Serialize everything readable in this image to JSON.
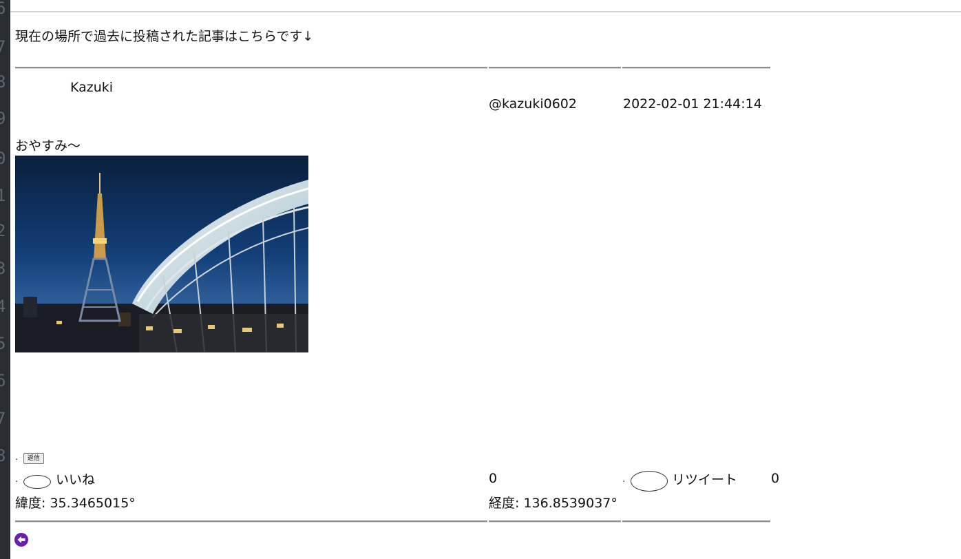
{
  "gutter": {
    "line_numbers": [
      "6",
      "7",
      "8",
      "9",
      "0",
      "1",
      "2",
      "3",
      "4",
      "5",
      "6",
      "7",
      "8"
    ]
  },
  "intro_text": "現在の場所で過去に投稿された記事はこちらです↓",
  "post": {
    "user_name": "Kazuki",
    "handle": "@kazuki0602",
    "timestamp": "2022-02-01 21:44:14",
    "body": "おやすみ〜",
    "image": {
      "description": "night-cityscape-photo"
    },
    "reply": {
      "dot": ".",
      "label": "返信"
    },
    "like": {
      "dot": ".",
      "label": "いいね",
      "count": "0"
    },
    "retweet": {
      "dot": ".",
      "label": "リツイート",
      "count": "0"
    },
    "latitude": "緯度: 35.3465015°",
    "longitude": "経度: 136.8539037°"
  },
  "back": {
    "icon": "arrow-left-circle-icon",
    "color": "#6a1fb0"
  }
}
